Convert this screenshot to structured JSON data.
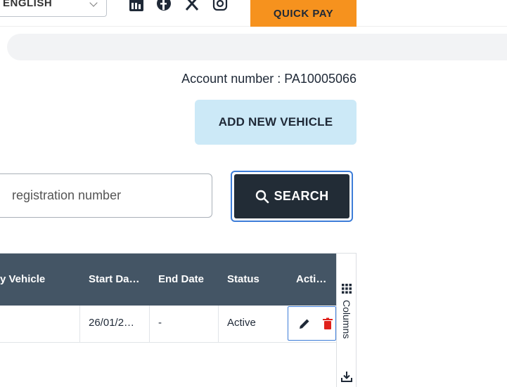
{
  "header": {
    "language_label": "ENGLISH",
    "quick_pay_label": "QUICK PAY",
    "social_icons": [
      "linkedin-icon",
      "facebook-icon",
      "x-icon",
      "instagram-icon"
    ]
  },
  "account": {
    "text": "Account number : PA10005066"
  },
  "actions": {
    "add_vehicle_label": "ADD NEW VEHICLE"
  },
  "search": {
    "placeholder": "registration number",
    "button_label": "SEARCH"
  },
  "grid": {
    "headers": {
      "vehicle": "y Vehicle",
      "start_date": "Start Da…",
      "end_date": "End Date",
      "status": "Status",
      "actions": "Acti…"
    },
    "rows": [
      {
        "start_date": "26/01/2…",
        "end_date": "-",
        "status": "Active"
      }
    ],
    "columns_label": "Columns"
  },
  "colors": {
    "accent_orange": "#f6921e",
    "header_bg": "#445565",
    "search_btn_bg": "#222c36",
    "add_btn_bg": "#cce9f7",
    "delete_red": "#e0211b"
  }
}
